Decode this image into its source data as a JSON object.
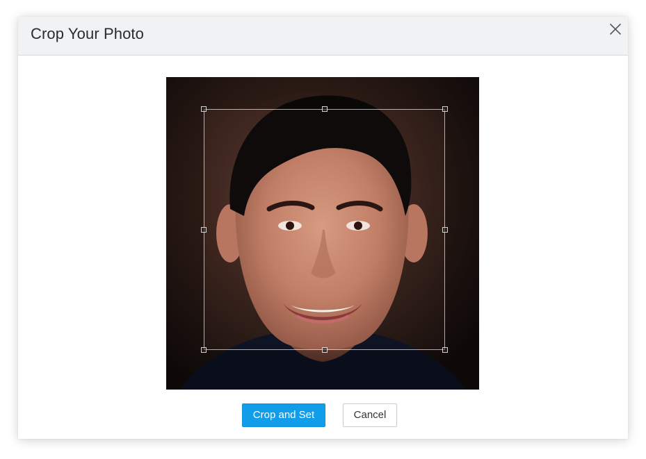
{
  "dialog": {
    "title": "Crop Your Photo",
    "close_icon": "close-icon"
  },
  "photo": {
    "subject": "portrait-photo",
    "crop_handles": [
      "top-left",
      "top-middle",
      "top-right",
      "middle-left",
      "middle-right",
      "bottom-left",
      "bottom-middle",
      "bottom-right"
    ]
  },
  "actions": {
    "primary_label": "Crop and Set",
    "secondary_label": "Cancel"
  },
  "colors": {
    "primary": "#109de9",
    "header_bg": "#f1f2f4",
    "title_text": "#2b2b2b"
  }
}
